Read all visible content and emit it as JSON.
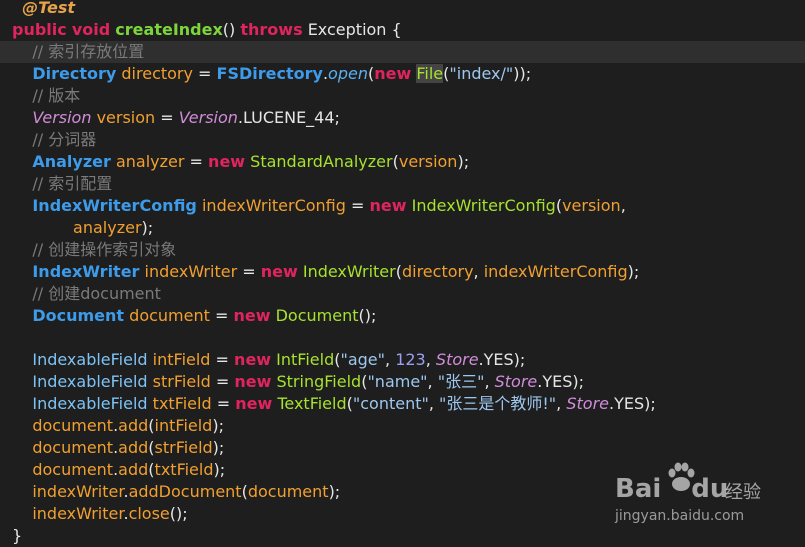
{
  "editor": {
    "lines": [
      {
        "indent": "  ",
        "active": false,
        "tokens": [
          {
            "t": "@Test",
            "c": "k-annotation"
          }
        ]
      },
      {
        "indent": "",
        "active": false,
        "tokens": [
          {
            "t": "public",
            "c": "k-keyword"
          },
          {
            "t": " ",
            "c": "k-plain"
          },
          {
            "t": "void",
            "c": "k-keyword"
          },
          {
            "t": " ",
            "c": "k-plain"
          },
          {
            "t": "createIndex",
            "c": "k-method-decl"
          },
          {
            "t": "() ",
            "c": "k-plain"
          },
          {
            "t": "throws",
            "c": "k-keyword"
          },
          {
            "t": " Exception {",
            "c": "k-plain"
          }
        ]
      },
      {
        "indent": "    ",
        "active": true,
        "tokens": [
          {
            "t": "// 索引存放位置",
            "c": "k-comment"
          }
        ]
      },
      {
        "indent": "    ",
        "active": false,
        "tokens": [
          {
            "t": "Directory",
            "c": "k-type"
          },
          {
            "t": " ",
            "c": "k-plain"
          },
          {
            "t": "directory",
            "c": "k-var"
          },
          {
            "t": " = ",
            "c": "k-plain"
          },
          {
            "t": "FSDirectory",
            "c": "k-type"
          },
          {
            "t": ".",
            "c": "k-plain"
          },
          {
            "t": "open",
            "c": "k-italic-blue"
          },
          {
            "t": "(",
            "c": "k-plain"
          },
          {
            "t": "new",
            "c": "k-keyword"
          },
          {
            "t": " ",
            "c": "k-plain"
          },
          {
            "t": "File",
            "c": "k-class k-hl"
          },
          {
            "t": "(",
            "c": "k-plain"
          },
          {
            "t": "\"index/\"",
            "c": "k-string"
          },
          {
            "t": "));",
            "c": "k-plain"
          }
        ]
      },
      {
        "indent": "    ",
        "active": false,
        "tokens": [
          {
            "t": "// 版本",
            "c": "k-comment"
          }
        ]
      },
      {
        "indent": "    ",
        "active": false,
        "tokens": [
          {
            "t": "Version",
            "c": "k-italic"
          },
          {
            "t": " ",
            "c": "k-plain"
          },
          {
            "t": "version",
            "c": "k-var"
          },
          {
            "t": " = ",
            "c": "k-plain"
          },
          {
            "t": "Version",
            "c": "k-italic"
          },
          {
            "t": ".LUCENE_44;",
            "c": "k-plain"
          }
        ]
      },
      {
        "indent": "    ",
        "active": false,
        "tokens": [
          {
            "t": "// 分词器",
            "c": "k-comment"
          }
        ]
      },
      {
        "indent": "    ",
        "active": false,
        "tokens": [
          {
            "t": "Analyzer",
            "c": "k-type"
          },
          {
            "t": " ",
            "c": "k-plain"
          },
          {
            "t": "analyzer",
            "c": "k-var"
          },
          {
            "t": " = ",
            "c": "k-plain"
          },
          {
            "t": "new",
            "c": "k-keyword"
          },
          {
            "t": " ",
            "c": "k-plain"
          },
          {
            "t": "StandardAnalyzer",
            "c": "k-class"
          },
          {
            "t": "(",
            "c": "k-plain"
          },
          {
            "t": "version",
            "c": "k-var"
          },
          {
            "t": ");",
            "c": "k-plain"
          }
        ]
      },
      {
        "indent": "    ",
        "active": false,
        "tokens": [
          {
            "t": "// 索引配置",
            "c": "k-comment"
          }
        ]
      },
      {
        "indent": "    ",
        "active": false,
        "tokens": [
          {
            "t": "IndexWriterConfig",
            "c": "k-type"
          },
          {
            "t": " ",
            "c": "k-plain"
          },
          {
            "t": "indexWriterConfig",
            "c": "k-var"
          },
          {
            "t": " = ",
            "c": "k-plain"
          },
          {
            "t": "new",
            "c": "k-keyword"
          },
          {
            "t": " ",
            "c": "k-plain"
          },
          {
            "t": "IndexWriterConfig",
            "c": "k-class"
          },
          {
            "t": "(",
            "c": "k-plain"
          },
          {
            "t": "version",
            "c": "k-var"
          },
          {
            "t": ",",
            "c": "k-plain"
          }
        ]
      },
      {
        "indent": "            ",
        "active": false,
        "tokens": [
          {
            "t": "analyzer",
            "c": "k-var"
          },
          {
            "t": ");",
            "c": "k-plain"
          }
        ]
      },
      {
        "indent": "    ",
        "active": false,
        "tokens": [
          {
            "t": "// 创建操作索引对象",
            "c": "k-comment"
          }
        ]
      },
      {
        "indent": "    ",
        "active": false,
        "tokens": [
          {
            "t": "IndexWriter",
            "c": "k-type"
          },
          {
            "t": " ",
            "c": "k-plain"
          },
          {
            "t": "indexWriter",
            "c": "k-var"
          },
          {
            "t": " = ",
            "c": "k-plain"
          },
          {
            "t": "new",
            "c": "k-keyword"
          },
          {
            "t": " ",
            "c": "k-plain"
          },
          {
            "t": "IndexWriter",
            "c": "k-class"
          },
          {
            "t": "(",
            "c": "k-plain"
          },
          {
            "t": "directory",
            "c": "k-var"
          },
          {
            "t": ", ",
            "c": "k-plain"
          },
          {
            "t": "indexWriterConfig",
            "c": "k-var"
          },
          {
            "t": ");",
            "c": "k-plain"
          }
        ]
      },
      {
        "indent": "    ",
        "active": false,
        "tokens": [
          {
            "t": "// 创建document",
            "c": "k-comment"
          }
        ]
      },
      {
        "indent": "    ",
        "active": false,
        "tokens": [
          {
            "t": "Document",
            "c": "k-type"
          },
          {
            "t": " ",
            "c": "k-plain"
          },
          {
            "t": "document",
            "c": "k-var"
          },
          {
            "t": " = ",
            "c": "k-plain"
          },
          {
            "t": "new",
            "c": "k-keyword"
          },
          {
            "t": " ",
            "c": "k-plain"
          },
          {
            "t": "Document",
            "c": "k-class"
          },
          {
            "t": "();",
            "c": "k-plain"
          }
        ]
      },
      {
        "indent": "",
        "active": false,
        "tokens": []
      },
      {
        "indent": "    ",
        "active": false,
        "tokens": [
          {
            "t": "IndexableField",
            "c": "k-type-plain"
          },
          {
            "t": " ",
            "c": "k-plain"
          },
          {
            "t": "intField",
            "c": "k-var"
          },
          {
            "t": " = ",
            "c": "k-plain"
          },
          {
            "t": "new",
            "c": "k-keyword"
          },
          {
            "t": " ",
            "c": "k-plain"
          },
          {
            "t": "IntField",
            "c": "k-class"
          },
          {
            "t": "(",
            "c": "k-plain"
          },
          {
            "t": "\"age\"",
            "c": "k-string"
          },
          {
            "t": ", ",
            "c": "k-plain"
          },
          {
            "t": "123",
            "c": "k-number"
          },
          {
            "t": ", ",
            "c": "k-plain"
          },
          {
            "t": "Store",
            "c": "k-italic"
          },
          {
            "t": ".YES);",
            "c": "k-plain"
          }
        ]
      },
      {
        "indent": "    ",
        "active": false,
        "tokens": [
          {
            "t": "IndexableField",
            "c": "k-type-plain"
          },
          {
            "t": " ",
            "c": "k-plain"
          },
          {
            "t": "strField",
            "c": "k-var"
          },
          {
            "t": " = ",
            "c": "k-plain"
          },
          {
            "t": "new",
            "c": "k-keyword"
          },
          {
            "t": " ",
            "c": "k-plain"
          },
          {
            "t": "StringField",
            "c": "k-class"
          },
          {
            "t": "(",
            "c": "k-plain"
          },
          {
            "t": "\"name\"",
            "c": "k-string"
          },
          {
            "t": ", ",
            "c": "k-plain"
          },
          {
            "t": "\"张三\"",
            "c": "k-string"
          },
          {
            "t": ", ",
            "c": "k-plain"
          },
          {
            "t": "Store",
            "c": "k-italic"
          },
          {
            "t": ".YES);",
            "c": "k-plain"
          }
        ]
      },
      {
        "indent": "    ",
        "active": false,
        "tokens": [
          {
            "t": "IndexableField",
            "c": "k-type-plain"
          },
          {
            "t": " ",
            "c": "k-plain"
          },
          {
            "t": "txtField",
            "c": "k-var"
          },
          {
            "t": " = ",
            "c": "k-plain"
          },
          {
            "t": "new",
            "c": "k-keyword"
          },
          {
            "t": " ",
            "c": "k-plain"
          },
          {
            "t": "TextField",
            "c": "k-class"
          },
          {
            "t": "(",
            "c": "k-plain"
          },
          {
            "t": "\"content\"",
            "c": "k-string"
          },
          {
            "t": ", ",
            "c": "k-plain"
          },
          {
            "t": "\"张三是个教师!\"",
            "c": "k-string"
          },
          {
            "t": ", ",
            "c": "k-plain"
          },
          {
            "t": "Store",
            "c": "k-italic"
          },
          {
            "t": ".YES);",
            "c": "k-plain"
          }
        ]
      },
      {
        "indent": "    ",
        "active": false,
        "tokens": [
          {
            "t": "document",
            "c": "k-call"
          },
          {
            "t": ".",
            "c": "k-plain"
          },
          {
            "t": "add",
            "c": "k-call"
          },
          {
            "t": "(",
            "c": "k-plain"
          },
          {
            "t": "intField",
            "c": "k-var"
          },
          {
            "t": ");",
            "c": "k-plain"
          }
        ]
      },
      {
        "indent": "    ",
        "active": false,
        "tokens": [
          {
            "t": "document",
            "c": "k-call"
          },
          {
            "t": ".",
            "c": "k-plain"
          },
          {
            "t": "add",
            "c": "k-call"
          },
          {
            "t": "(",
            "c": "k-plain"
          },
          {
            "t": "strField",
            "c": "k-var"
          },
          {
            "t": ");",
            "c": "k-plain"
          }
        ]
      },
      {
        "indent": "    ",
        "active": false,
        "tokens": [
          {
            "t": "document",
            "c": "k-call"
          },
          {
            "t": ".",
            "c": "k-plain"
          },
          {
            "t": "add",
            "c": "k-call"
          },
          {
            "t": "(",
            "c": "k-plain"
          },
          {
            "t": "txtField",
            "c": "k-var"
          },
          {
            "t": ");",
            "c": "k-plain"
          }
        ]
      },
      {
        "indent": "    ",
        "active": false,
        "tokens": [
          {
            "t": "indexWriter",
            "c": "k-call"
          },
          {
            "t": ".",
            "c": "k-plain"
          },
          {
            "t": "addDocument",
            "c": "k-call"
          },
          {
            "t": "(",
            "c": "k-plain"
          },
          {
            "t": "document",
            "c": "k-var"
          },
          {
            "t": ");",
            "c": "k-plain"
          }
        ]
      },
      {
        "indent": "    ",
        "active": false,
        "tokens": [
          {
            "t": "indexWriter",
            "c": "k-call"
          },
          {
            "t": ".",
            "c": "k-plain"
          },
          {
            "t": "close",
            "c": "k-call"
          },
          {
            "t": "();",
            "c": "k-plain"
          }
        ]
      },
      {
        "indent": "",
        "active": false,
        "tokens": [
          {
            "t": "}",
            "c": "k-plain"
          }
        ]
      }
    ]
  },
  "watermark": {
    "logo_text": "Bai",
    "logo_icon": "baidu-paw-icon",
    "logo_suffix": "du",
    "product": "经验",
    "url": "jingyan.baidu.com"
  },
  "colors": {
    "background": "#1e1e1e",
    "active_line": "#2f2f2f",
    "keyword": "#e0245e",
    "type": "#3d9be9",
    "variable": "#f0a030",
    "comment": "#7a7a7a",
    "string": "#9ec7ef",
    "class": "#a6e22e"
  }
}
